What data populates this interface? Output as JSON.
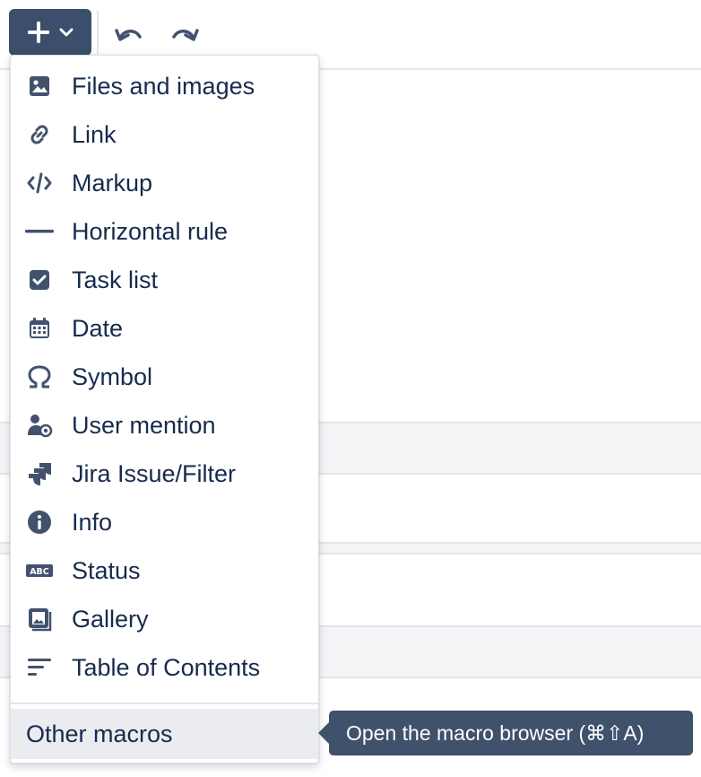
{
  "colors": {
    "text": "#172b4d",
    "icon": "#42526e",
    "insert_button_bg": "#3b4e6b",
    "tooltip_bg": "#3f516b",
    "hover_bg": "#ebecf0"
  },
  "toolbar": {
    "insert_button": {
      "icon": "plus-icon",
      "dropdown_icon": "chevron-down-icon"
    },
    "undo_icon": "undo-icon",
    "redo_icon": "redo-icon"
  },
  "menu": {
    "items": [
      {
        "label": "Files and images",
        "icon": "image-icon"
      },
      {
        "label": "Link",
        "icon": "link-icon"
      },
      {
        "label": "Markup",
        "icon": "code-icon"
      },
      {
        "label": "Horizontal rule",
        "icon": "horizontal-rule-icon"
      },
      {
        "label": "Task list",
        "icon": "checkbox-icon"
      },
      {
        "label": "Date",
        "icon": "calendar-icon"
      },
      {
        "label": "Symbol",
        "icon": "omega-icon"
      },
      {
        "label": "User mention",
        "icon": "user-mention-icon"
      },
      {
        "label": "Jira Issue/Filter",
        "icon": "jira-icon"
      },
      {
        "label": "Info",
        "icon": "info-icon"
      },
      {
        "label": "Status",
        "icon": "status-abc-icon"
      },
      {
        "label": "Gallery",
        "icon": "gallery-icon"
      },
      {
        "label": "Table of Contents",
        "icon": "table-of-contents-icon"
      }
    ],
    "other": {
      "label": "Other macros"
    }
  },
  "tooltip": {
    "text": "Open the macro browser (⌘⇧A)"
  }
}
